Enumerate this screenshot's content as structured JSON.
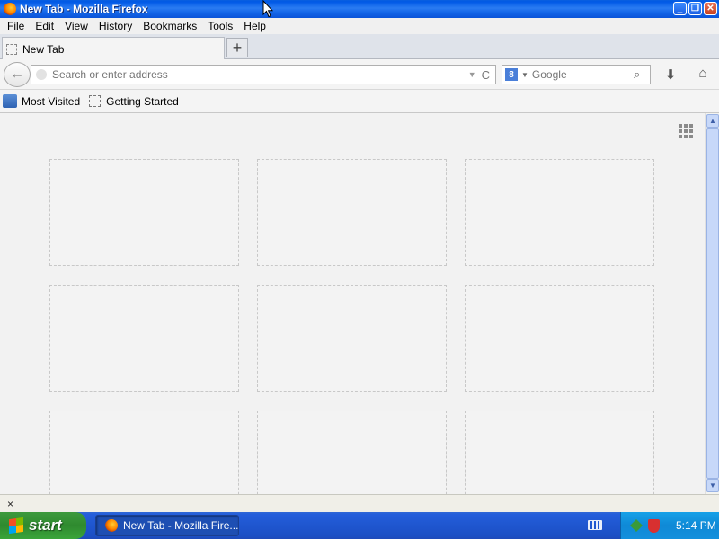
{
  "window": {
    "title": "New Tab - Mozilla Firefox",
    "minimize_label": "_",
    "maximize_label": "❐",
    "close_label": "✕"
  },
  "menu": {
    "items": [
      "File",
      "Edit",
      "View",
      "History",
      "Bookmarks",
      "Tools",
      "Help"
    ]
  },
  "tabs": {
    "active_label": "New Tab",
    "new_tab_label": "+"
  },
  "navbar": {
    "back_label": "←",
    "address_placeholder": "Search or enter address",
    "dropmarker_label": "▼",
    "reload_label": "C",
    "search_engine_label": "8",
    "search_placeholder": "Google",
    "search_go_label": "⌕",
    "download_label": "⬇",
    "home_label": "⌂"
  },
  "bookmarks": {
    "items": [
      "Most Visited",
      "Getting Started"
    ]
  },
  "content": {
    "tile_count": 9
  },
  "findbar": {
    "close_label": "×"
  },
  "taskbar": {
    "start_label": "start",
    "task_label": "New Tab - Mozilla Fire...",
    "clock": "5:14 PM"
  }
}
